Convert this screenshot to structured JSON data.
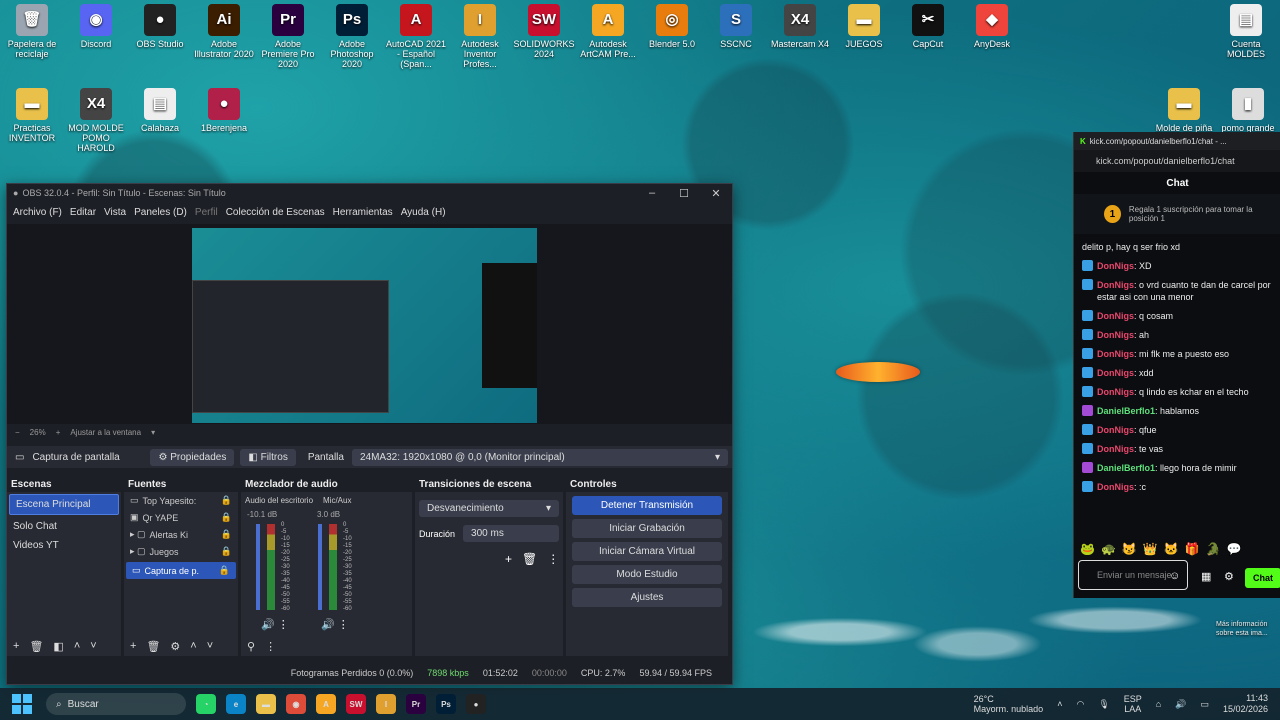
{
  "desktop": {
    "icons": [
      {
        "label": "Papelera de reciclaje",
        "glyph": "🗑",
        "bg": "#9aa5b1"
      },
      {
        "label": "Discord",
        "glyph": "◉",
        "bg": "#5865f2"
      },
      {
        "label": "OBS Studio",
        "glyph": "●",
        "bg": "#222"
      },
      {
        "label": "Adobe Illustrator 2020",
        "glyph": "Ai",
        "bg": "#3b1d00"
      },
      {
        "label": "Adobe Premiere Pro 2020",
        "glyph": "Pr",
        "bg": "#2a003f"
      },
      {
        "label": "Adobe Photoshop 2020",
        "glyph": "Ps",
        "bg": "#001e36"
      },
      {
        "label": "AutoCAD 2021 - Español (Span...",
        "glyph": "A",
        "bg": "#c5161d"
      },
      {
        "label": "Autodesk Inventor Profes...",
        "glyph": "I",
        "bg": "#e0a030"
      },
      {
        "label": "SOLIDWORKS 2024",
        "glyph": "SW",
        "bg": "#c8102e"
      },
      {
        "label": "Autodesk ArtCAM Pre...",
        "glyph": "A",
        "bg": "#f5a623"
      },
      {
        "label": "Blender 5.0",
        "glyph": "◎",
        "bg": "#e87d0d"
      },
      {
        "label": "SSCNC",
        "glyph": "S",
        "bg": "#2c6fbb"
      },
      {
        "label": "Mastercam X4",
        "glyph": "X4",
        "bg": "#444"
      },
      {
        "label": "JUEGOS",
        "glyph": "▬",
        "bg": "#e8c04a"
      },
      {
        "label": "CapCut",
        "glyph": "✂",
        "bg": "#111"
      },
      {
        "label": "AnyDesk",
        "glyph": "◆",
        "bg": "#ef443b"
      },
      {
        "label": "Cuenta MOLDES",
        "glyph": "▤",
        "bg": "#eee"
      },
      {
        "label": "Practicas INVENTOR",
        "glyph": "▬",
        "bg": "#e8c04a"
      },
      {
        "label": "MOD MOLDE POMO HAROLD",
        "glyph": "X4",
        "bg": "#444"
      },
      {
        "label": "Calabaza",
        "glyph": "▤",
        "bg": "#eee"
      },
      {
        "label": "1Berenjena",
        "glyph": "●",
        "bg": "#b02048"
      },
      {
        "label": "Molde de piña",
        "glyph": "▬",
        "bg": "#e8c04a"
      },
      {
        "label": "pomo grande",
        "glyph": "▮",
        "bg": "#ddd"
      }
    ]
  },
  "obs": {
    "title": "OBS 32.0.4 - Perfil: Sin Título - Escenas: Sin Título",
    "menu": [
      "Archivo (F)",
      "Editar",
      "Vista",
      "Paneles (D)",
      "Perfil",
      "Colección de Escenas",
      "Herramientas",
      "Ayuda (H)"
    ],
    "zoom": {
      "value": "26%",
      "fit": "Ajustar a la ventana"
    },
    "source_bar": {
      "name": "Captura de pantalla",
      "properties": "Propiedades",
      "filters": "Filtros",
      "screen_label": "Pantalla",
      "screen_value": "24MA32: 1920x1080 @ 0,0 (Monitor principal)"
    },
    "scenes": {
      "title": "Escenas",
      "items": [
        "Escena Principal",
        "Solo Chat",
        "Videos YT"
      ]
    },
    "sources": {
      "title": "Fuentes",
      "items": [
        "Top Yapesito:",
        "Qr YAPE",
        "Alertas Ki",
        "Juegos",
        "Captura de p."
      ]
    },
    "mixer": {
      "title": "Mezclador de audio",
      "channels": [
        {
          "name": "Audio del escritorio",
          "db": "-10.1 dB"
        },
        {
          "name": "Mic/Aux",
          "db": "3.0 dB"
        }
      ],
      "scale": [
        "0",
        "-5",
        "-10",
        "-15",
        "-20",
        "-25",
        "-30",
        "-35",
        "-40",
        "-45",
        "-50",
        "-55",
        "-60"
      ]
    },
    "transitions": {
      "title": "Transiciones de escena",
      "type": "Desvanecimiento",
      "duration_label": "Duración",
      "duration": "300 ms"
    },
    "controls": {
      "title": "Controles",
      "buttons": [
        "Detener Transmisión",
        "Iniciar Grabación",
        "Iniciar Cámara Virtual",
        "Modo Estudio",
        "Ajustes"
      ]
    },
    "status": {
      "dropped": "Fotogramas Perdidos 0 (0.0%)",
      "bitrate": "7898 kbps",
      "live_time": "01:52:02",
      "rec_time": "00:00:00",
      "cpu": "CPU: 2.7%",
      "fps": "59.94 / 59.94 FPS"
    }
  },
  "kick": {
    "window_title": "kick.com/popout/danielberflo1/chat - ...",
    "url": "kick.com/popout/danielberflo1/chat",
    "header": "Chat",
    "pinned": {
      "badge": "1",
      "text": "Regala 1 suscripción para tomar la posición 1"
    },
    "messages": [
      {
        "user": "",
        "text": "delito p, hay q ser frio xd",
        "color": ""
      },
      {
        "user": "DonNigs",
        "text": ": XD",
        "color": "red"
      },
      {
        "user": "DonNigs",
        "text": ": o vrd cuanto te dan de carcel por estar asi con una menor",
        "color": "red"
      },
      {
        "user": "DonNigs",
        "text": ": q cosam",
        "color": "red"
      },
      {
        "user": "DonNigs",
        "text": ": ah",
        "color": "red"
      },
      {
        "user": "DonNigs",
        "text": ": mi flk me a puesto eso",
        "color": "red"
      },
      {
        "user": "DonNigs",
        "text": ": xdd",
        "color": "red"
      },
      {
        "user": "DonNigs",
        "text": ": q lindo es kchar en el techo",
        "color": "red"
      },
      {
        "user": "DanielBerflo1",
        "text": ": hablamos",
        "color": "green"
      },
      {
        "user": "DonNigs",
        "text": ": qfue",
        "color": "red"
      },
      {
        "user": "DonNigs",
        "text": ": te vas",
        "color": "red"
      },
      {
        "user": "DanielBerflo1",
        "text": ": llego hora de mimir",
        "color": "green"
      },
      {
        "user": "DonNigs",
        "text": ": :c",
        "color": "red"
      }
    ],
    "input_placeholder": "Enviar un mensaje",
    "send_label": "Chat"
  },
  "taskbar": {
    "search": "Buscar",
    "weather_temp": "26°C",
    "weather_desc": "Mayorm. nublado",
    "lang": "ESP",
    "lang2": "LAA",
    "time": "11:43",
    "date": "15/02/2026"
  },
  "misc": {
    "notice": "Más información sobre esta ima..."
  }
}
